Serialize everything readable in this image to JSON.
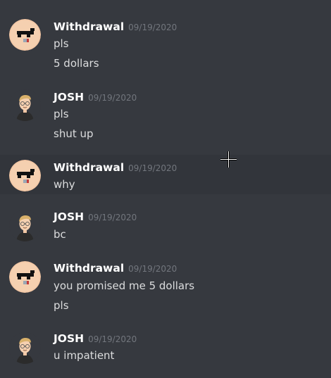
{
  "messages": [
    {
      "author": "Withdrawal",
      "avatar": "withdrawal-avatar-icon",
      "timestamp": "09/19/2020",
      "lines": [
        "pls",
        "5 dollars"
      ]
    },
    {
      "author": "JOSH",
      "avatar": "josh-avatar-icon",
      "timestamp": "09/19/2020",
      "lines": [
        "pls",
        "shut up"
      ]
    },
    {
      "author": "Withdrawal",
      "avatar": "withdrawal-avatar-icon",
      "timestamp": "09/19/2020",
      "lines": [
        "why"
      ]
    },
    {
      "author": "JOSH",
      "avatar": "josh-avatar-icon",
      "timestamp": "09/19/2020",
      "lines": [
        "bc"
      ]
    },
    {
      "author": "Withdrawal",
      "avatar": "withdrawal-avatar-icon",
      "timestamp": "09/19/2020",
      "lines": [
        "you promised me 5 dollars",
        "pls"
      ]
    },
    {
      "author": "JOSH",
      "avatar": "josh-avatar-icon",
      "timestamp": "09/19/2020",
      "lines": [
        "u impatient"
      ]
    }
  ],
  "colors": {
    "background": "#36393f",
    "hover_background": "#32353b",
    "author": "#ffffff",
    "text": "#dcddde",
    "timestamp": "#72767d"
  },
  "cursor": "crosshair-cursor-icon"
}
